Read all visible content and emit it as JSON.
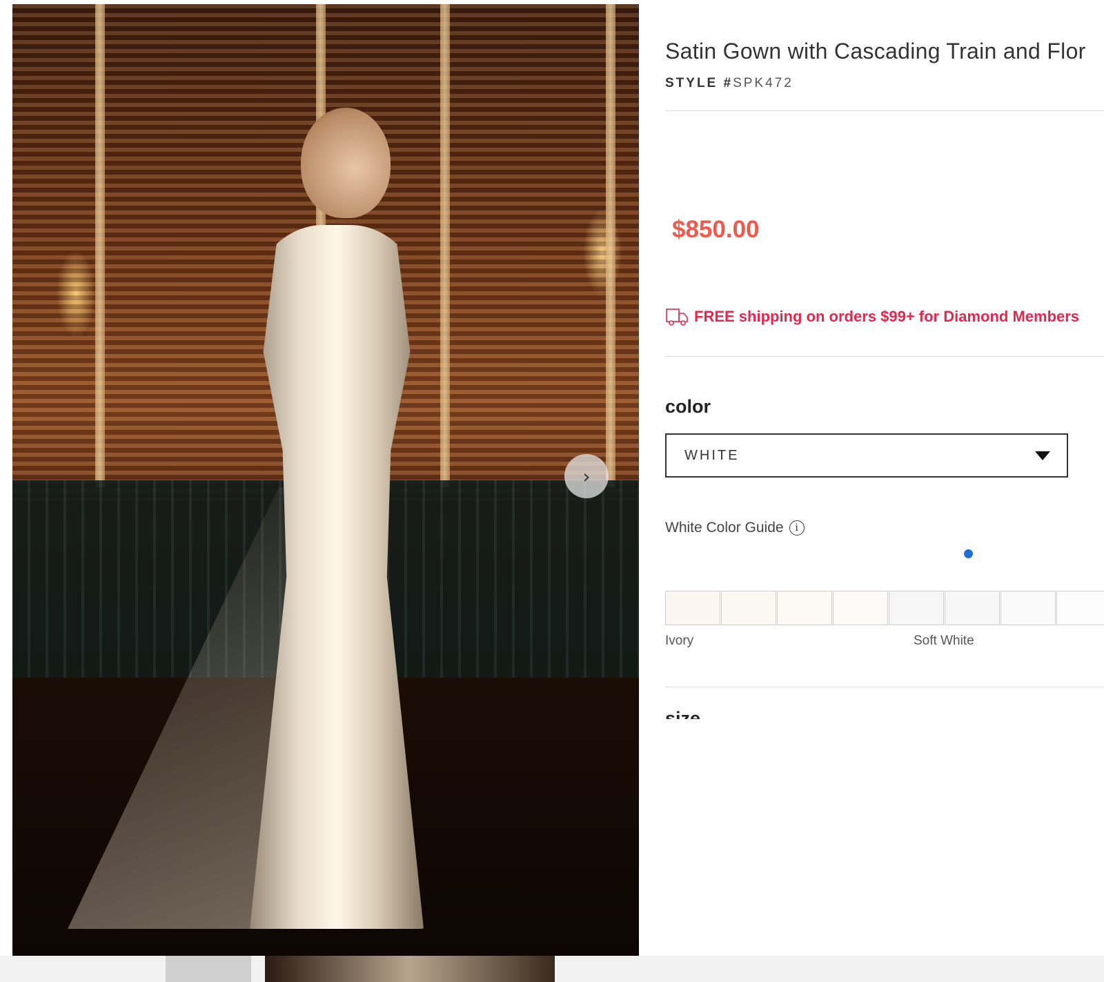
{
  "product": {
    "title": "Satin Gown with Cascading Train and Flor",
    "style_label": "STYLE #",
    "style_number": "SPK472",
    "price": "$850.00",
    "shipping_text": "FREE shipping on orders $99+ for Diamond Members",
    "color_heading": "color",
    "color_selected": "WHITE",
    "color_guide_label": "White Color Guide",
    "info_glyph": "i",
    "size_heading": "size"
  },
  "swatches": [
    {
      "color": "#fbf6ef"
    },
    {
      "color": "#fbf7f1"
    },
    {
      "color": "#fcf9f4"
    },
    {
      "color": "#fdfbf8"
    },
    {
      "color": "#f6f6f6"
    },
    {
      "color": "#f7f7f7"
    },
    {
      "color": "#f9f9f9"
    },
    {
      "color": "#fcfcfc"
    }
  ],
  "swatch_labels": {
    "ivory": "Ivory",
    "soft_white": "Soft White"
  },
  "gallery": {
    "next_icon": "chevron-right-icon",
    "next_glyph": "›"
  },
  "colors": {
    "price": "#ef5a4d",
    "shipping": "#e8264d",
    "marker": "#1f6fd6"
  }
}
